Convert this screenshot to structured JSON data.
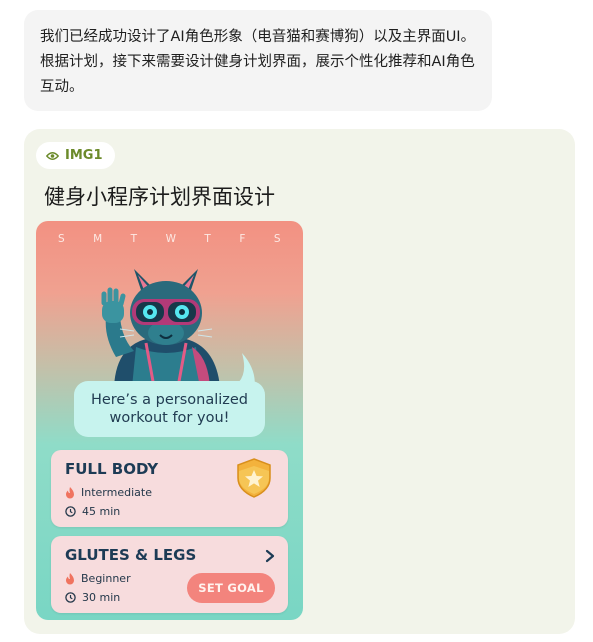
{
  "message": {
    "text": "我们已经成功设计了AI角色形象（电音猫和赛博狗）以及主界面UI。根据计划，接下来需要设计健身计划界面，展示个性化推荐和AI角色互动。"
  },
  "image_card": {
    "chip_label": "IMG1",
    "title": "健身小程序计划界面设计"
  },
  "app": {
    "weekdays": [
      "S",
      "M",
      "T",
      "W",
      "T",
      "F",
      "S"
    ],
    "speech_line1": "Here’s a personalized",
    "speech_line2": "workout for you!",
    "workouts": [
      {
        "title": "FULL BODY",
        "level": "Intermediate",
        "duration": "45 min",
        "badge": "star-badge-icon"
      },
      {
        "title": "GLUTES & LEGS",
        "level": "Beginner",
        "duration": "30 min",
        "action": "SET GOAL"
      }
    ],
    "colors": {
      "gradient_top": "#f29182",
      "gradient_bottom": "#79d6c4",
      "card_bg": "#f7dcdd",
      "accent": "#f3847d",
      "text_dark": "#1d3b55"
    }
  }
}
